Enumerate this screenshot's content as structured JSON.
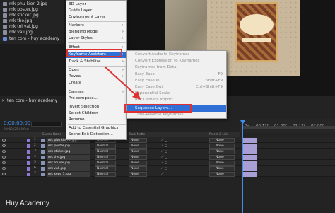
{
  "project_panel": {
    "items": [
      {
        "label": "mk phu kien 2.jpg",
        "type": "file"
      },
      {
        "label": "mk poster.jpg",
        "type": "file"
      },
      {
        "label": "mk sticker.jpg",
        "type": "file"
      },
      {
        "label": "mk the.jpg",
        "type": "file"
      },
      {
        "label": "mk toi vai.jpg",
        "type": "file"
      },
      {
        "label": "mk vali.jpg",
        "type": "file"
      },
      {
        "label": "ten com - huy academy",
        "type": "composition"
      }
    ]
  },
  "context_menu": {
    "items": [
      {
        "label": "3D Layer",
        "submenu": false
      },
      {
        "label": "Guide Layer",
        "submenu": false
      },
      {
        "label": "Environment Layer",
        "submenu": false
      },
      {
        "label": "Markers",
        "submenu": true
      },
      {
        "label": "Blending Mode",
        "submenu": true
      },
      {
        "label": "Layer Styles",
        "submenu": true
      },
      {
        "label": "Effect",
        "submenu": true
      },
      {
        "label": "Keyframe Assistant",
        "submenu": true,
        "highlighted": true
      },
      {
        "label": "Track & Stabilize",
        "submenu": true
      },
      {
        "label": "Open",
        "submenu": true
      },
      {
        "label": "Reveal",
        "submenu": true
      },
      {
        "label": "Create",
        "submenu": true
      },
      {
        "label": "Camera",
        "submenu": true
      },
      {
        "label": "Pre-compose...",
        "submenu": false
      },
      {
        "label": "Invert Selection",
        "submenu": false
      },
      {
        "label": "Select Children",
        "submenu": false
      },
      {
        "label": "Rename",
        "submenu": false
      },
      {
        "label": "Add to Essential Graphics",
        "submenu": false
      },
      {
        "label": "Scene Edit Detection...",
        "submenu": false
      }
    ]
  },
  "keyframe_submenu": {
    "items": [
      {
        "label": "Convert Audio to Keyframes",
        "shortcut": ""
      },
      {
        "label": "Convert Expression to Keyframes",
        "shortcut": ""
      },
      {
        "label": "Keyframes from Data",
        "shortcut": ""
      },
      {
        "label": "Easy Ease",
        "shortcut": "F9"
      },
      {
        "label": "Easy Ease In",
        "shortcut": "Shift+F9"
      },
      {
        "label": "Easy Ease Out",
        "shortcut": "Ctrl+Shift+F9"
      },
      {
        "label": "Exponential Scale",
        "shortcut": ""
      },
      {
        "label": "RPF Camera Import",
        "shortcut": ""
      },
      {
        "label": "Sequence Layers...",
        "shortcut": "",
        "highlighted": true
      },
      {
        "label": "Time-Reverse Keyframes",
        "shortcut": ""
      }
    ]
  },
  "timeline": {
    "tab_label": "ten com - huy academy",
    "timecode": "0:00:00:00",
    "fps_label": "00000 (25.00 fps)",
    "column_headers": {
      "source_name": "Source Name",
      "mode": "Mode",
      "track_matte": "Track Matte",
      "parent_link": "Parent & Link"
    },
    "ruler_ticks": [
      "0s",
      "00:12f",
      "01:00f",
      "01:12f",
      "02:00f"
    ],
    "layers": [
      {
        "num": "1",
        "name": "mk phu kien 2.jpg",
        "mode": "Normal",
        "matte": "None",
        "parent": "None"
      },
      {
        "num": "2",
        "name": "mk poster.jpg",
        "mode": "Normal",
        "matte": "None",
        "parent": "None"
      },
      {
        "num": "3",
        "name": "mk sticker.jpg",
        "mode": "Normal",
        "matte": "None",
        "parent": "None"
      },
      {
        "num": "4",
        "name": "mk the.jpg",
        "mode": "Normal",
        "matte": "None",
        "parent": "None"
      },
      {
        "num": "5",
        "name": "mk toi vai.jpg",
        "mode": "Normal",
        "matte": "None",
        "parent": "None"
      },
      {
        "num": "6",
        "name": "mk vali.jpg",
        "mode": "Normal",
        "matte": "None",
        "parent": "None"
      },
      {
        "num": "7",
        "name": "mk kepo 1.jpg",
        "mode": "Normal",
        "matte": "None",
        "parent": "None"
      }
    ]
  },
  "watermark": "Huy Academy",
  "colors": {
    "accent_blue": "#2f6fd6",
    "timecode_blue": "#3f8fe6",
    "annotation_red": "#e03030",
    "layer_label_purple": "#8e7ad6",
    "layer_bar": "#a99fd6"
  }
}
